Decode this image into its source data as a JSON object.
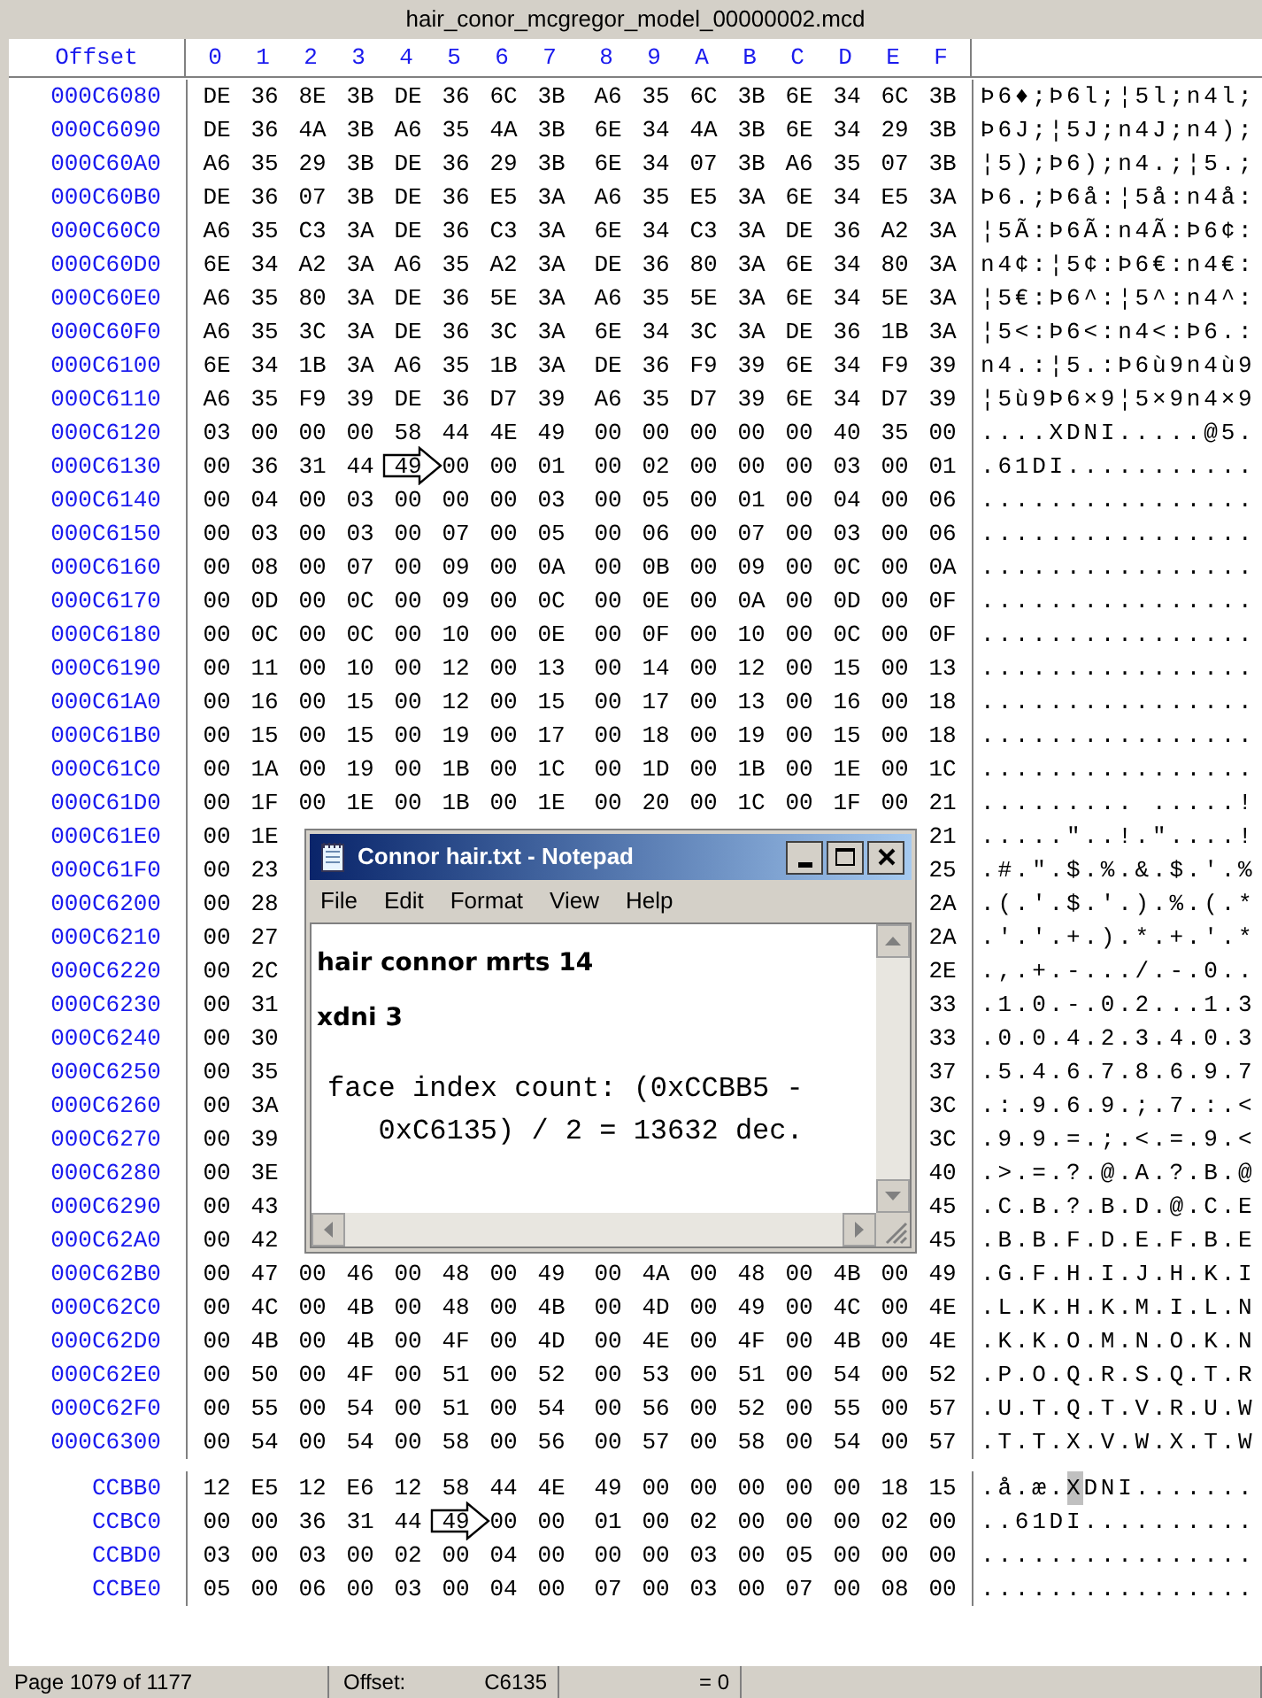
{
  "window": {
    "title": "hair_conor_mcgregor_model_00000002.mcd"
  },
  "header": {
    "offset": "Offset",
    "columns": [
      "0",
      "1",
      "2",
      "3",
      "4",
      "5",
      "6",
      "7",
      "8",
      "9",
      "A",
      "B",
      "C",
      "D",
      "E",
      "F"
    ]
  },
  "sections": [
    {
      "rows": [
        {
          "offset": "000C6080",
          "bytes": [
            "DE",
            "36",
            "8E",
            "3B",
            "DE",
            "36",
            "6C",
            "3B",
            "A6",
            "35",
            "6C",
            "3B",
            "6E",
            "34",
            "6C",
            "3B"
          ],
          "ascii": "Þ6♦;Þ6l;¦5l;n4l;"
        },
        {
          "offset": "000C6090",
          "bytes": [
            "DE",
            "36",
            "4A",
            "3B",
            "A6",
            "35",
            "4A",
            "3B",
            "6E",
            "34",
            "4A",
            "3B",
            "6E",
            "34",
            "29",
            "3B"
          ],
          "ascii": "Þ6J;¦5J;n4J;n4);"
        },
        {
          "offset": "000C60A0",
          "bytes": [
            "A6",
            "35",
            "29",
            "3B",
            "DE",
            "36",
            "29",
            "3B",
            "6E",
            "34",
            "07",
            "3B",
            "A6",
            "35",
            "07",
            "3B"
          ],
          "ascii": "¦5);Þ6);n4.;¦5.;"
        },
        {
          "offset": "000C60B0",
          "bytes": [
            "DE",
            "36",
            "07",
            "3B",
            "DE",
            "36",
            "E5",
            "3A",
            "A6",
            "35",
            "E5",
            "3A",
            "6E",
            "34",
            "E5",
            "3A"
          ],
          "ascii": "Þ6.;Þ6å:¦5å:n4å:"
        },
        {
          "offset": "000C60C0",
          "bytes": [
            "A6",
            "35",
            "C3",
            "3A",
            "DE",
            "36",
            "C3",
            "3A",
            "6E",
            "34",
            "C3",
            "3A",
            "DE",
            "36",
            "A2",
            "3A"
          ],
          "ascii": "¦5Ã:Þ6Ã:n4Ã:Þ6¢:"
        },
        {
          "offset": "000C60D0",
          "bytes": [
            "6E",
            "34",
            "A2",
            "3A",
            "A6",
            "35",
            "A2",
            "3A",
            "DE",
            "36",
            "80",
            "3A",
            "6E",
            "34",
            "80",
            "3A"
          ],
          "ascii": "n4¢:¦5¢:Þ6€:n4€:"
        },
        {
          "offset": "000C60E0",
          "bytes": [
            "A6",
            "35",
            "80",
            "3A",
            "DE",
            "36",
            "5E",
            "3A",
            "A6",
            "35",
            "5E",
            "3A",
            "6E",
            "34",
            "5E",
            "3A"
          ],
          "ascii": "¦5€:Þ6^:¦5^:n4^:"
        },
        {
          "offset": "000C60F0",
          "bytes": [
            "A6",
            "35",
            "3C",
            "3A",
            "DE",
            "36",
            "3C",
            "3A",
            "6E",
            "34",
            "3C",
            "3A",
            "DE",
            "36",
            "1B",
            "3A"
          ],
          "ascii": "¦5<:Þ6<:n4<:Þ6.:"
        },
        {
          "offset": "000C6100",
          "bytes": [
            "6E",
            "34",
            "1B",
            "3A",
            "A6",
            "35",
            "1B",
            "3A",
            "DE",
            "36",
            "F9",
            "39",
            "6E",
            "34",
            "F9",
            "39"
          ],
          "ascii": "n4.:¦5.:Þ6ù9n4ù9"
        },
        {
          "offset": "000C6110",
          "bytes": [
            "A6",
            "35",
            "F9",
            "39",
            "DE",
            "36",
            "D7",
            "39",
            "A6",
            "35",
            "D7",
            "39",
            "6E",
            "34",
            "D7",
            "39"
          ],
          "ascii": "¦5ù9Þ6×9¦5×9n4×9"
        },
        {
          "offset": "000C6120",
          "bytes": [
            "03",
            "00",
            "00",
            "00",
            "58",
            "44",
            "4E",
            "49",
            "00",
            "00",
            "00",
            "00",
            "00",
            "40",
            "35",
            "00"
          ],
          "ascii": "....XDNI.....@5."
        },
        {
          "offset": "000C6130",
          "bytes": [
            "00",
            "36",
            "31",
            "44",
            {
              "text": "49",
              "kind": "arrow"
            },
            "00",
            "00",
            "01",
            "00",
            "02",
            "00",
            "00",
            "00",
            "03",
            "00",
            "01"
          ],
          "ascii": ".61DI..........."
        },
        {
          "offset": "000C6140",
          "bytes": [
            "00",
            "04",
            "00",
            "03",
            "00",
            "00",
            "00",
            "03",
            "00",
            "05",
            "00",
            "01",
            "00",
            "04",
            "00",
            "06"
          ],
          "ascii": "................"
        },
        {
          "offset": "000C6150",
          "bytes": [
            "00",
            "03",
            "00",
            "03",
            "00",
            "07",
            "00",
            "05",
            "00",
            "06",
            "00",
            "07",
            "00",
            "03",
            "00",
            "06"
          ],
          "ascii": "................"
        },
        {
          "offset": "000C6160",
          "bytes": [
            "00",
            "08",
            "00",
            "07",
            "00",
            "09",
            "00",
            "0A",
            "00",
            "0B",
            "00",
            "09",
            "00",
            "0C",
            "00",
            "0A"
          ],
          "ascii": "................"
        },
        {
          "offset": "000C6170",
          "bytes": [
            "00",
            "0D",
            "00",
            "0C",
            "00",
            "09",
            "00",
            "0C",
            "00",
            "0E",
            "00",
            "0A",
            "00",
            "0D",
            "00",
            "0F"
          ],
          "ascii": "................"
        },
        {
          "offset": "000C6180",
          "bytes": [
            "00",
            "0C",
            "00",
            "0C",
            "00",
            "10",
            "00",
            "0E",
            "00",
            "0F",
            "00",
            "10",
            "00",
            "0C",
            "00",
            "0F"
          ],
          "ascii": "................"
        },
        {
          "offset": "000C6190",
          "bytes": [
            "00",
            "11",
            "00",
            "10",
            "00",
            "12",
            "00",
            "13",
            "00",
            "14",
            "00",
            "12",
            "00",
            "15",
            "00",
            "13"
          ],
          "ascii": "................"
        },
        {
          "offset": "000C61A0",
          "bytes": [
            "00",
            "16",
            "00",
            "15",
            "00",
            "12",
            "00",
            "15",
            "00",
            "17",
            "00",
            "13",
            "00",
            "16",
            "00",
            "18"
          ],
          "ascii": "................"
        },
        {
          "offset": "000C61B0",
          "bytes": [
            "00",
            "15",
            "00",
            "15",
            "00",
            "19",
            "00",
            "17",
            "00",
            "18",
            "00",
            "19",
            "00",
            "15",
            "00",
            "18"
          ],
          "ascii": "................"
        },
        {
          "offset": "000C61C0",
          "bytes": [
            "00",
            "1A",
            "00",
            "19",
            "00",
            "1B",
            "00",
            "1C",
            "00",
            "1D",
            "00",
            "1B",
            "00",
            "1E",
            "00",
            "1C"
          ],
          "ascii": "................"
        },
        {
          "offset": "000C61D0",
          "bytes": [
            "00",
            "1F",
            "00",
            "1E",
            "00",
            "1B",
            "00",
            "1E",
            "00",
            "20",
            "00",
            "1C",
            "00",
            "1F",
            "00",
            "21"
          ],
          "ascii": "......... .....!"
        },
        {
          "offset": "000C61E0",
          "bytes": [
            "00",
            "1E"
          ],
          "bytes_end": [
            "21"
          ],
          "ascii": ".....\"..!.\"....!"
        },
        {
          "offset": "000C61F0",
          "bytes": [
            "00",
            "23"
          ],
          "bytes_end": [
            "25"
          ],
          "ascii": ".#.\".$.%.&.$.'.%"
        },
        {
          "offset": "000C6200",
          "bytes": [
            "00",
            "28"
          ],
          "bytes_end": [
            "2A"
          ],
          "ascii": ".(.'.$.'.).%.(.*"
        },
        {
          "offset": "000C6210",
          "bytes": [
            "00",
            "27"
          ],
          "bytes_end": [
            "2A"
          ],
          "ascii": ".'.'.+.).*.+.'.*"
        },
        {
          "offset": "000C6220",
          "bytes": [
            "00",
            "2C"
          ],
          "bytes_end": [
            "2E"
          ],
          "ascii": ".,.+.-.../.-.0.."
        },
        {
          "offset": "000C6230",
          "bytes": [
            "00",
            "31"
          ],
          "bytes_end": [
            "33"
          ],
          "ascii": ".1.0.-.0.2...1.3"
        },
        {
          "offset": "000C6240",
          "bytes": [
            "00",
            "30"
          ],
          "bytes_end": [
            "33"
          ],
          "ascii": ".0.0.4.2.3.4.0.3"
        },
        {
          "offset": "000C6250",
          "bytes": [
            "00",
            "35"
          ],
          "bytes_end": [
            "37"
          ],
          "ascii": ".5.4.6.7.8.6.9.7"
        },
        {
          "offset": "000C6260",
          "bytes": [
            "00",
            "3A"
          ],
          "bytes_end": [
            "3C"
          ],
          "ascii": ".:.9.6.9.;.7.:.<"
        },
        {
          "offset": "000C6270",
          "bytes": [
            "00",
            "39"
          ],
          "bytes_end": [
            "3C"
          ],
          "ascii": ".9.9.=.;.<.=.9.<"
        },
        {
          "offset": "000C6280",
          "bytes": [
            "00",
            "3E"
          ],
          "bytes_end": [
            "40"
          ],
          "ascii": ".>.=.?.@.A.?.B.@"
        },
        {
          "offset": "000C6290",
          "bytes": [
            "00",
            "43"
          ],
          "bytes_end": [
            "45"
          ],
          "ascii": ".C.B.?.B.D.@.C.E"
        },
        {
          "offset": "000C62A0",
          "bytes": [
            "00",
            "42"
          ],
          "bytes_end": [
            "45"
          ],
          "ascii": ".B.B.F.D.E.F.B.E"
        },
        {
          "offset": "000C62B0",
          "bytes": [
            "00",
            "47",
            "00",
            "46",
            "00",
            "48",
            "00",
            "49",
            "00",
            "4A",
            "00",
            "48",
            "00",
            "4B",
            "00",
            "49"
          ],
          "ascii": ".G.F.H.I.J.H.K.I"
        },
        {
          "offset": "000C62C0",
          "bytes": [
            "00",
            "4C",
            "00",
            "4B",
            "00",
            "48",
            "00",
            "4B",
            "00",
            "4D",
            "00",
            "49",
            "00",
            "4C",
            "00",
            "4E"
          ],
          "ascii": ".L.K.H.K.M.I.L.N"
        },
        {
          "offset": "000C62D0",
          "bytes": [
            "00",
            "4B",
            "00",
            "4B",
            "00",
            "4F",
            "00",
            "4D",
            "00",
            "4E",
            "00",
            "4F",
            "00",
            "4B",
            "00",
            "4E"
          ],
          "ascii": ".K.K.O.M.N.O.K.N"
        },
        {
          "offset": "000C62E0",
          "bytes": [
            "00",
            "50",
            "00",
            "4F",
            "00",
            "51",
            "00",
            "52",
            "00",
            "53",
            "00",
            "51",
            "00",
            "54",
            "00",
            "52"
          ],
          "ascii": ".P.O.Q.R.S.Q.T.R"
        },
        {
          "offset": "000C62F0",
          "bytes": [
            "00",
            "55",
            "00",
            "54",
            "00",
            "51",
            "00",
            "54",
            "00",
            "56",
            "00",
            "52",
            "00",
            "55",
            "00",
            "57"
          ],
          "ascii": ".U.T.Q.T.V.R.U.W"
        },
        {
          "offset": "000C6300",
          "bytes": [
            "00",
            "54",
            "00",
            "54",
            "00",
            "58",
            "00",
            "56",
            "00",
            "57",
            "00",
            "58",
            "00",
            "54",
            "00",
            "57"
          ],
          "ascii": ".T.T.X.V.W.X.T.W"
        }
      ]
    },
    {
      "rows": [
        {
          "offset": "CCBB0",
          "bytes": [
            "12",
            "E5",
            "12",
            "E6",
            "12",
            "58",
            "44",
            "4E",
            "49",
            "00",
            "00",
            "00",
            "00",
            "00",
            "18",
            "15"
          ],
          "ascii": [
            ".å.æ.",
            {
              "text": "X",
              "kind": "cursor"
            },
            "DNI......."
          ]
        },
        {
          "offset": "CCBC0",
          "bytes": [
            "00",
            "00",
            "36",
            "31",
            "44",
            {
              "text": "49",
              "kind": "arrow"
            },
            "00",
            "00",
            "01",
            "00",
            "02",
            "00",
            "00",
            "00",
            "02",
            "00"
          ],
          "ascii": "..61DI.........."
        },
        {
          "offset": "CCBD0",
          "bytes": [
            "03",
            "00",
            "03",
            "00",
            "02",
            "00",
            "04",
            "00",
            "00",
            "00",
            "03",
            "00",
            "05",
            "00",
            "00",
            "00"
          ],
          "ascii": "................"
        },
        {
          "offset": "CCBE0",
          "bytes": [
            "05",
            "00",
            "06",
            "00",
            "03",
            "00",
            "04",
            "00",
            "07",
            "00",
            "03",
            "00",
            "07",
            "00",
            "08",
            "00"
          ],
          "ascii": "................"
        }
      ]
    }
  ],
  "notepad": {
    "title": "Connor hair.txt - Notepad",
    "menu": [
      "File",
      "Edit",
      "Format",
      "View",
      "Help"
    ],
    "lines": [
      {
        "kind": "bold",
        "text": "hair connor mrts 14"
      },
      {
        "kind": "bold",
        "text": "xdni 3"
      },
      {
        "kind": "mono",
        "text": "face index count: (0xCCBB5 -"
      },
      {
        "kind": "mono",
        "text": "   0xC6135) / 2 = 13632 dec."
      }
    ]
  },
  "status_bar": {
    "page": "Page 1079 of 1177",
    "offset_label": "Offset:",
    "offset_value": "C6135",
    "value": "= 0"
  }
}
